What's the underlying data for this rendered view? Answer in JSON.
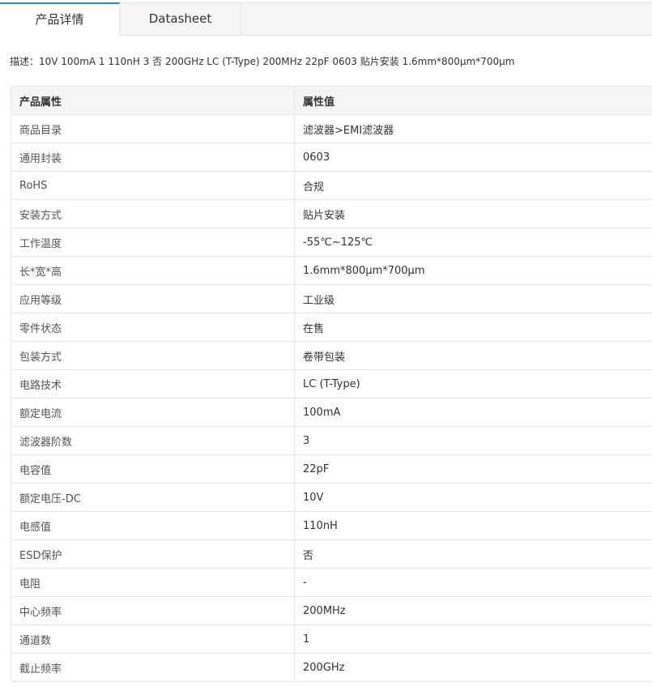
{
  "tabs": [
    {
      "label": "产品详情",
      "active": true
    },
    {
      "label": "Datasheet",
      "active": false
    }
  ],
  "description": "描述：10V 100mA 1 110nH 3 否 200GHz LC (T-Type) 200MHz 22pF 0603 贴片安装 1.6mm*800μm*700μm",
  "table": {
    "headers": {
      "attribute": "产品属性",
      "value": "属性值"
    },
    "rows": [
      {
        "attribute": "商品目录",
        "value": "滤波器>EMI滤波器"
      },
      {
        "attribute": "通用封装",
        "value": "0603"
      },
      {
        "attribute": "RoHS",
        "value": "合规"
      },
      {
        "attribute": "安装方式",
        "value": "贴片安装"
      },
      {
        "attribute": "工作温度",
        "value": "-55℃~125℃"
      },
      {
        "attribute": "长*宽*高",
        "value": "1.6mm*800μm*700μm"
      },
      {
        "attribute": "应用等级",
        "value": "工业级"
      },
      {
        "attribute": "零件状态",
        "value": "在售"
      },
      {
        "attribute": "包装方式",
        "value": "卷带包装"
      },
      {
        "attribute": "电路技术",
        "value": "LC (T-Type)"
      },
      {
        "attribute": "额定电流",
        "value": "100mA"
      },
      {
        "attribute": "滤波器阶数",
        "value": "3"
      },
      {
        "attribute": "电容值",
        "value": "22pF"
      },
      {
        "attribute": "额定电压-DC",
        "value": "10V"
      },
      {
        "attribute": "电感值",
        "value": "110nH"
      },
      {
        "attribute": "ESD保护",
        "value": "否"
      },
      {
        "attribute": "电阻",
        "value": "-"
      },
      {
        "attribute": "中心频率",
        "value": "200MHz"
      },
      {
        "attribute": "通道数",
        "value": "1"
      },
      {
        "attribute": "截止频率",
        "value": "200GHz"
      }
    ]
  },
  "colors": {
    "tab_accent": "#1f8fd6",
    "header_bg": "#f5f5f5",
    "border": "#e8e8e8"
  }
}
